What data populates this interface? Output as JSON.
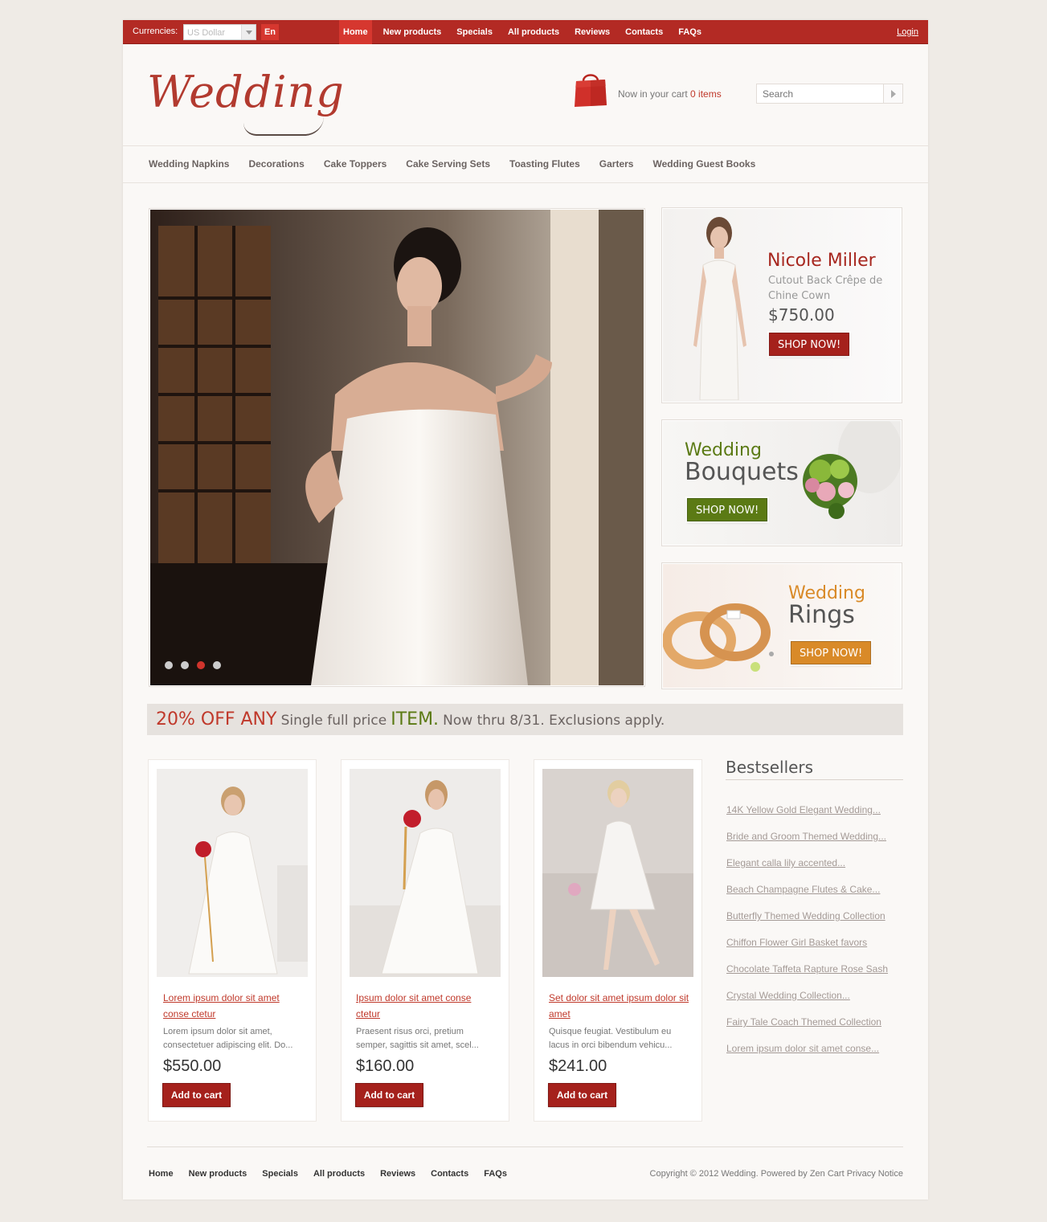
{
  "topbar": {
    "currencies_label": "Currencies:",
    "currency_selected": "US Dollar",
    "language": "En",
    "nav": [
      "Home",
      "New products",
      "Specials",
      "All products",
      "Reviews",
      "Contacts",
      "FAQs"
    ],
    "login": "Login"
  },
  "header": {
    "logo": "Wedding",
    "cart_text": "Now in your cart",
    "cart_count": "0 items",
    "search_placeholder": "Search"
  },
  "categories": [
    "Wedding Napkins",
    "Decorations",
    "Cake Toppers",
    "Cake Serving Sets",
    "Toasting Flutes",
    "Garters",
    "Wedding Guest Books"
  ],
  "slider": {
    "active_dot_index": 2,
    "dot_count": 4
  },
  "banners": {
    "nicole": {
      "title": "Nicole Miller",
      "subtitle": "Cutout Back Crêpe de Chine Cown",
      "price": "$750.00",
      "button": "SHOP NOW!"
    },
    "bouquets": {
      "line1": "Wedding",
      "line2": "Bouquets",
      "button": "SHOP NOW!"
    },
    "rings": {
      "line1": "Wedding",
      "line2": "Rings",
      "button": "SHOP NOW!"
    }
  },
  "promo": {
    "part1": "20% OFF ANY",
    "part2": "Single full price",
    "part3": "ITEM.",
    "part4": "Now thru 8/31. Exclusions apply."
  },
  "products": [
    {
      "name": "Lorem ipsum dolor sit amet conse ctetur",
      "desc": "Lorem ipsum dolor sit amet, consectetuer adipiscing elit. Do...",
      "price": "$550.00",
      "button": "Add to cart"
    },
    {
      "name": "Ipsum dolor sit amet conse ctetur",
      "desc": "Praesent risus orci, pretium semper, sagittis sit amet, scel...",
      "price": "$160.00",
      "button": "Add to cart"
    },
    {
      "name": "Set dolor sit amet ipsum dolor sit amet",
      "desc": "Quisque feugiat. Vestibulum eu lacus in orci bibendum vehicu...",
      "price": "$241.00",
      "button": "Add to cart"
    }
  ],
  "bestsellers": {
    "title": "Bestsellers",
    "items": [
      "14K Yellow Gold Elegant Wedding...",
      "Bride and Groom Themed Wedding...",
      "Elegant calla lily accented...",
      "Beach Champagne Flutes & Cake...",
      "Butterfly Themed Wedding Collection",
      "Chiffon Flower Girl Basket favors",
      "Chocolate Taffeta Rapture Rose Sash",
      "Crystal Wedding Collection...",
      "Fairy Tale Coach Themed Collection",
      "Lorem ipsum dolor sit amet conse..."
    ]
  },
  "footer": {
    "nav": [
      "Home",
      "New products",
      "Specials",
      "All products",
      "Reviews",
      "Contacts",
      "FAQs"
    ],
    "copyright": "Copyright © 2012 Wedding. Powered by Zen Cart Privacy Notice"
  },
  "colors": {
    "brand_red": "#b32a24",
    "accent_red": "#c0392b",
    "green": "#5b7a14",
    "orange": "#d98a28"
  }
}
